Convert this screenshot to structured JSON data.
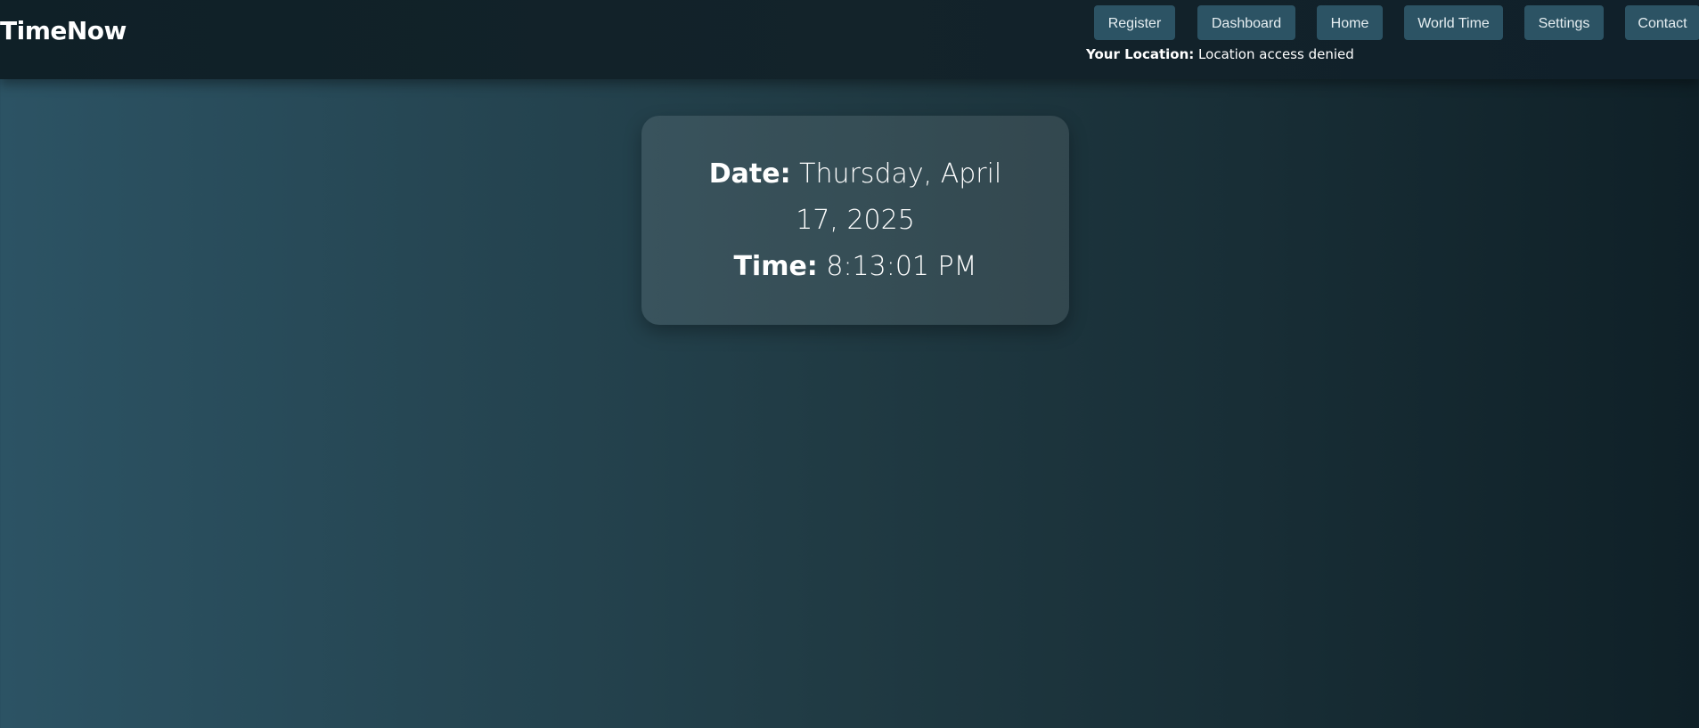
{
  "header": {
    "brand": "TimeNow",
    "nav": [
      "Register",
      "Dashboard",
      "Home",
      "World Time",
      "Settings",
      "Contact"
    ],
    "location": {
      "label": "Your Location:",
      "value": "Location access denied"
    }
  },
  "clock_card": {
    "date_label": "Date:",
    "date_value": "Thursday, April 17, 2025",
    "time_label": "Time:",
    "time_value": "8:13:01 PM"
  },
  "colors": {
    "background_start": "#2c5364",
    "background_mid": "#203a43",
    "background_end": "#0f2027",
    "button_bg": "#2c5364",
    "text": "#ffffff"
  }
}
